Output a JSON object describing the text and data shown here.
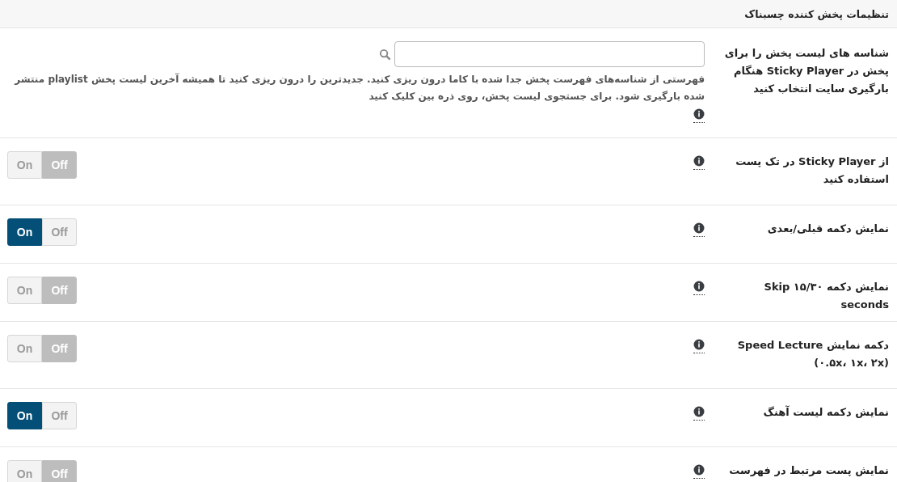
{
  "header": {
    "title": "تنظیمات پخش کننده چسبناک"
  },
  "playlist_setting": {
    "label": "شناسه های لیست پخش را برای پخش در Sticky Player هنگام بارگیری سایت انتخاب کنید",
    "description": "فهرستی از شناسه‌های فهرست پخش جدا شده با کاما درون ریزی کنید. جدیدترین را درون ریزی کنید تا همیشه آخرین لیست پخش playlist منتشر شده بارگیری شود. برای جستجوی لیست پخش، روی ذره بین کلیک کنید"
  },
  "rows": [
    {
      "label": "از Sticky Player در تک پست استفاده کنید",
      "on": false,
      "on_label": "On",
      "off_label": "Off"
    },
    {
      "label": "نمایش دکمه قبلی/بعدی",
      "on": true,
      "on_label": "On",
      "off_label": "Off"
    },
    {
      "label": "نمایش دکمه Skip ۱۵/۳۰ seconds",
      "on": false,
      "on_label": "On",
      "off_label": "Off"
    },
    {
      "label": "دکمه نمایش Speed Lecture (۰.۵x، ۱x، ۲x)",
      "on": false,
      "on_label": "On",
      "off_label": "Off"
    },
    {
      "label": "نمایش دکمه لیست آهنگ",
      "on": true,
      "on_label": "On",
      "off_label": "Off"
    },
    {
      "label": "نمایش پست مرتبط در فهرست",
      "on": false,
      "on_label": "On",
      "off_label": "Off"
    }
  ]
}
